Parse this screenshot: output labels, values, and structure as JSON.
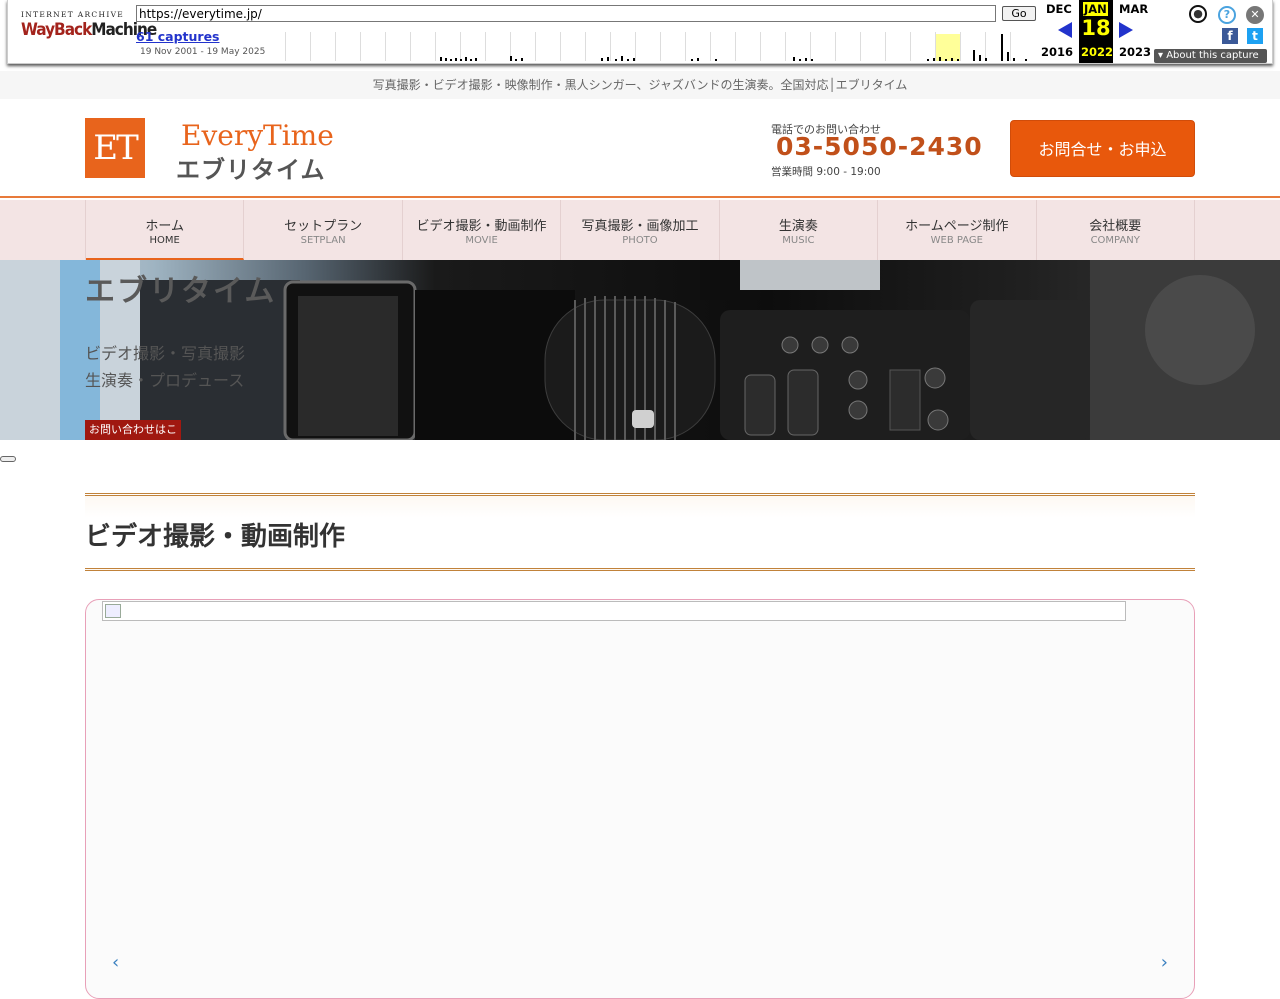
{
  "wayback": {
    "logo_top": "INTERNET ARCHIVE",
    "logo_word1": "WayBack",
    "logo_word2": "Machine",
    "url": "https://everytime.jp/",
    "go_label": "Go",
    "captures": "61 captures",
    "date_range": "19 Nov 2001 - 19 May 2025",
    "prev_month": "DEC",
    "prev_year": "2016",
    "current_month": "JAN",
    "current_day": "18",
    "current_year": "2022",
    "next_month": "MAR",
    "next_year": "2023",
    "about": "About this capture",
    "help_icon": "question-icon",
    "close_icon": "close-icon",
    "user_icon": "user-icon"
  },
  "site": {
    "tagline": "写真撮影・ビデオ撮影・映像制作・黒人シンガー、ジャズバンドの生演奏。全国対応│エブリタイム",
    "logo_mark": "ET",
    "logo_en": "EveryTime",
    "logo_jp": "エブリタイム",
    "tel_label": "電話でのお問い合わせ",
    "tel_number": "03-5050-2430",
    "tel_hours": "営業時間 9:00 - 19:00",
    "cta": "お問合せ・お申込",
    "nav": [
      {
        "jp": "ホーム",
        "en": "HOME"
      },
      {
        "jp": "セットプラン",
        "en": "SETPLAN"
      },
      {
        "jp": "ビデオ撮影・動画制作",
        "en": "MOVIE"
      },
      {
        "jp": "写真撮影・画像加工",
        "en": "PHOTO"
      },
      {
        "jp": "生演奏",
        "en": "MUSIC"
      },
      {
        "jp": "ホームページ制作",
        "en": "WEB PAGE"
      },
      {
        "jp": "会社概要",
        "en": "COMPANY"
      }
    ],
    "hero": {
      "title": "エブリタイム",
      "line1": "ビデオ撮影・写真撮影",
      "line2": "生演奏・プロデュース",
      "badge": "お問い合わせはこちら"
    },
    "section_title": "ビデオ撮影・動画制作",
    "accent_color": "#e8641c"
  }
}
